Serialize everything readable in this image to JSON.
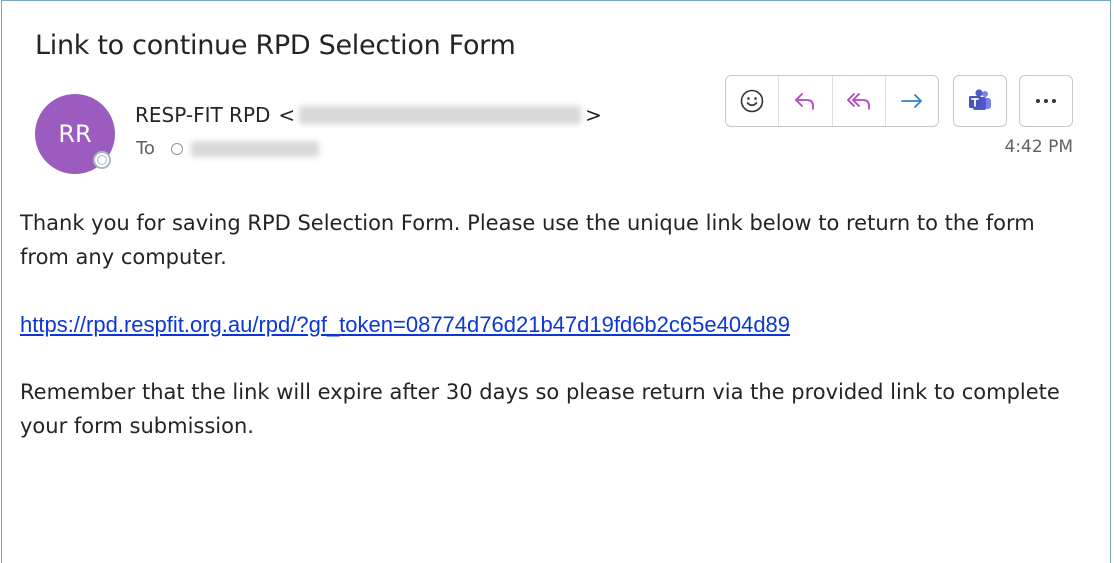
{
  "email": {
    "subject": "Link to continue RPD Selection Form",
    "sender": {
      "initials": "RR",
      "name": "RESP-FIT RPD",
      "open_bracket": "<",
      "close_bracket": ">"
    },
    "to_label": "To",
    "time": "4:42 PM",
    "body": {
      "paragraph1": "Thank you for saving RPD Selection Form. Please use the unique link below to return to the form from any computer.",
      "link": "https://rpd.respfit.org.au/rpd/?gf_token=08774d76d21b47d19fd6b2c65e404d89",
      "paragraph2": "Remember that the link will expire after 30 days so please return via the provided link to complete your form submission."
    }
  },
  "toolbar": {
    "icons": [
      "emoji-icon",
      "reply-icon",
      "reply-all-icon",
      "forward-icon",
      "teams-icon",
      "more-icon"
    ]
  },
  "colors": {
    "avatar": "#9b5bbf",
    "reply_icon": "#b146c2",
    "forward_icon": "#2f80d0",
    "teams": "#5059c9",
    "link": "#0b37d6"
  }
}
